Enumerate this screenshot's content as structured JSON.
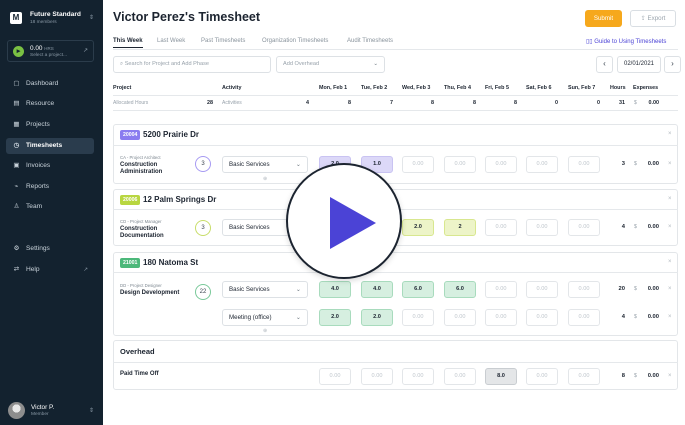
{
  "sidebar": {
    "org_name": "Future Standard",
    "org_members": "18 members",
    "logo_letter": "M",
    "hours_value": "0.00",
    "hours_unit": "HRS",
    "select_project": "Select a project...",
    "items": [
      {
        "label": "Dashboard",
        "icon": "dashboard-icon"
      },
      {
        "label": "Resource",
        "icon": "resource-icon"
      },
      {
        "label": "Projects",
        "icon": "projects-icon"
      },
      {
        "label": "Timesheets",
        "icon": "clock-icon"
      },
      {
        "label": "Invoices",
        "icon": "invoice-icon"
      },
      {
        "label": "Reports",
        "icon": "reports-icon"
      },
      {
        "label": "Team",
        "icon": "team-icon"
      },
      {
        "label": "Settings",
        "icon": "gear-icon"
      },
      {
        "label": "Help",
        "icon": "help-icon"
      }
    ],
    "user_name": "Victor P.",
    "user_role": "Member"
  },
  "header": {
    "title": "Victor Perez's Timesheet",
    "submit": "Submit",
    "export": "Export"
  },
  "tabs": [
    "This Week",
    "Last Week",
    "Past Timesheets",
    "Organization Timesheets",
    "Audit Timesheets"
  ],
  "guide": "Guide to Using Timesheets",
  "filters": {
    "search_placeholder": "Search for Project and Add Phase",
    "add_overhead": "Add Overhead",
    "date": "02/01/2021"
  },
  "columns": {
    "project": "Project",
    "activity": "Activity",
    "days": [
      "Mon, Feb 1",
      "Tue, Feb 2",
      "Wed, Feb 3",
      "Thu, Feb 4",
      "Fri, Feb 5",
      "Sat, Feb 6",
      "Sun, Feb 7"
    ],
    "hours": "Hours",
    "expenses": "Expenses"
  },
  "subheader": {
    "allocated_label": "Allocated Hours",
    "allocated_value": "28",
    "activities_label": "Activities",
    "activities_value": "4",
    "day_totals": [
      "8",
      "7",
      "8",
      "8",
      "8",
      "0",
      "0"
    ],
    "hours_total": "31",
    "currency": "$",
    "expenses_total": "0.00"
  },
  "projects": [
    {
      "number": "20004",
      "name": "5200 Prairie Dr",
      "color": "#8a7cf0",
      "role": "CA - Project Architect",
      "phase": "Construction Administration",
      "count": "3",
      "ring": "#a79bf2",
      "rows": [
        {
          "activity": "Basic Services",
          "cells": [
            "2.0",
            "1.0",
            "0.00",
            "0.00",
            "0.00",
            "0.00",
            "0.00"
          ],
          "hours": "3",
          "expenses": "0.00"
        }
      ]
    },
    {
      "number": "20006",
      "name": "12 Palm Springs Dr",
      "color": "#b8d640",
      "role": "CD - Project Manager",
      "phase": "Construction Documentation",
      "count": "3",
      "ring": "#c8dd6a",
      "rows": [
        {
          "activity": "Basic Services",
          "cells": [
            "",
            "",
            "2.0",
            "2",
            "0.00",
            "0.00",
            "0.00"
          ],
          "hours": "4",
          "expenses": "0.00"
        }
      ]
    },
    {
      "number": "21001",
      "name": "180 Natoma St",
      "color": "#4cb87a",
      "role": "DD - Project Designer",
      "phase": "Design Development",
      "count": "22",
      "ring": "#7ac99a",
      "rows": [
        {
          "activity": "Basic Services",
          "cells": [
            "4.0",
            "4.0",
            "6.0",
            "6.0",
            "0.00",
            "0.00",
            "0.00"
          ],
          "hours": "20",
          "expenses": "0.00"
        },
        {
          "activity": "Meeting (office)",
          "cells": [
            "2.0",
            "2.0",
            "0.00",
            "0.00",
            "0.00",
            "0.00",
            "0.00"
          ],
          "hours": "4",
          "expenses": "0.00"
        }
      ]
    }
  ],
  "overhead": {
    "title": "Overhead",
    "row_label": "Paid Time Off",
    "cells": [
      "0.00",
      "0.00",
      "0.00",
      "0.00",
      "8.0",
      "0.00",
      "0.00"
    ],
    "hours": "8",
    "expenses": "0.00"
  },
  "colors": {
    "accent": "#f6a81c",
    "sidebar": "#13222f",
    "link": "#4b43d6",
    "play": "#4b43d6"
  }
}
